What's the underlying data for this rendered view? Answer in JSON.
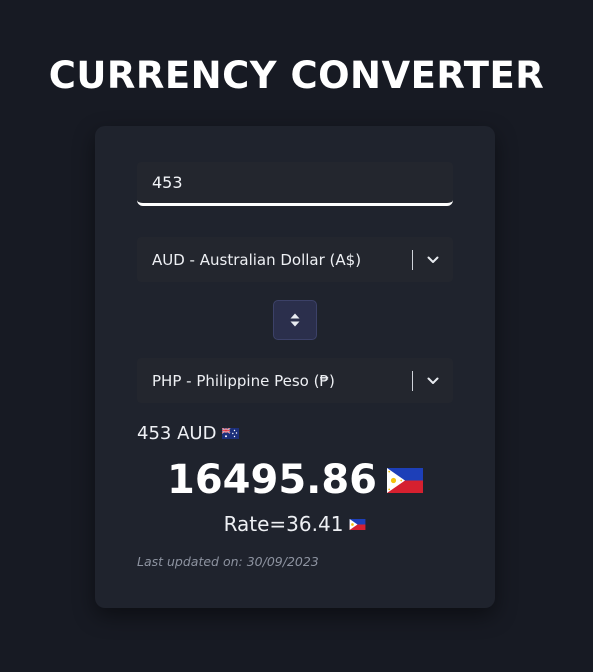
{
  "header": {
    "title": "CURRENCY CONVERTER"
  },
  "form": {
    "amount_value": "453",
    "from_currency": "AUD - Australian Dollar (A$)",
    "to_currency": "PHP - Philippine Peso (₱)"
  },
  "result": {
    "from_amount": "453 AUD",
    "converted_value": "16495.86",
    "rate_text": "Rate=36.41",
    "last_updated": "Last updated on: 30/09/2023"
  },
  "icons": {
    "from_flag": "australia-flag-icon",
    "to_flag": "philippines-flag-icon",
    "swap": "swap-arrows-icon",
    "dropdown": "chevron-down-icon"
  },
  "colors": {
    "background": "#171a23",
    "card": "#1f232d",
    "input": "#23262e",
    "swap_button": "#2b2f4c",
    "text": "#f2f4f8",
    "muted": "#8d93a0"
  }
}
